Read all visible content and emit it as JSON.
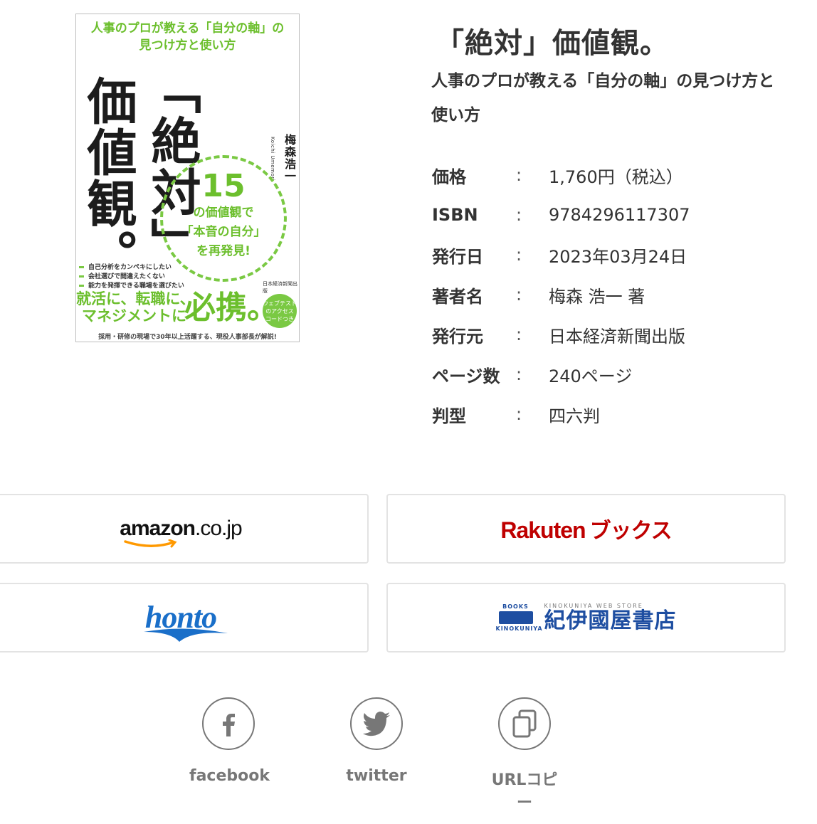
{
  "cover": {
    "subtitle_line1": "人事のプロが教える「自分の軸」の",
    "subtitle_line2": "見つけ方と使い方",
    "title_col1": "「絶対」",
    "title_col2": "価値観。",
    "author": "梅森浩一",
    "author_romaji": "Koichi Umemori",
    "circle_number": "15",
    "circle_line1": "の価値観で",
    "circle_line2": "「本音の自分」",
    "circle_line3": "を再発見!",
    "checks": [
      "自己分析をカンペキにしたい",
      "会社選びで間違えたくない",
      "能力を発揮できる職場を選びたい"
    ],
    "publisher": "日本経済新聞出版",
    "tagline_line1": "就活に、転職に、",
    "tagline_line2": "マネジメントに",
    "tagline_big": "必携。",
    "badge_line1": "ウェブテスト",
    "badge_line2": "のアクセス",
    "badge_line3": "コードつき",
    "bottom_text": "採用・研修の現場で30年以上活躍する、現役人事部長が解説!"
  },
  "book": {
    "title": "「絶対」価値観。",
    "subtitle": "人事のプロが教える「自分の軸」の見つけ方と使い方"
  },
  "info": [
    {
      "label": "価格",
      "colon": ":",
      "value": "1,760円（税込）"
    },
    {
      "label": "ISBN",
      "colon": ":",
      "value": "9784296117307"
    },
    {
      "label": "発行日",
      "colon": ":",
      "value": "2023年03月24日"
    },
    {
      "label": "著者名",
      "colon": ":",
      "value": "梅森 浩一 著"
    },
    {
      "label": "発行元",
      "colon": ":",
      "value": "日本経済新聞出版"
    },
    {
      "label": "ページ数",
      "colon": ":",
      "value": "240ページ"
    },
    {
      "label": "判型",
      "colon": ":",
      "value": "四六判"
    }
  ],
  "stores": {
    "amazon": {
      "main": "amazon",
      "suffix": ".co.jp"
    },
    "rakuten": {
      "main": "Rakuten",
      "kana": "ブックス"
    },
    "honto": {
      "main": "honto"
    },
    "kinokuniya": {
      "mark_top": "BOOKS",
      "mark_bottom": "KINOKUNIYA",
      "en": "KINOKUNIYA WEB STORE",
      "jp": "紀伊國屋書店"
    }
  },
  "share": {
    "facebook": "facebook",
    "twitter": "twitter",
    "url_copy": "URLコピー"
  },
  "colors": {
    "cover_green": "#7ac943",
    "rakuten_red": "#bf0000",
    "honto_blue": "#1a6fc9",
    "kinokuniya_blue": "#1e4ea1",
    "share_gray": "#777777"
  }
}
